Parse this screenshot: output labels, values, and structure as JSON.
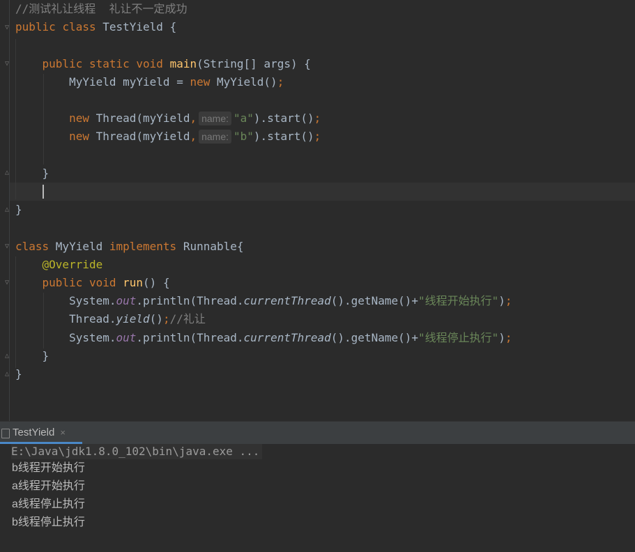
{
  "editor": {
    "lines": [
      {
        "parts": [
          {
            "t": "//测试礼让线程  礼让不一定成功",
            "c": "cmt"
          }
        ]
      },
      {
        "parts": [
          {
            "t": "public ",
            "c": "kw"
          },
          {
            "t": "class ",
            "c": "kw"
          },
          {
            "t": "TestYield {",
            "c": "cls"
          }
        ]
      },
      {
        "parts": []
      },
      {
        "parts": [
          {
            "t": "    "
          },
          {
            "t": "public ",
            "c": "kw"
          },
          {
            "t": "static ",
            "c": "kw"
          },
          {
            "t": "void ",
            "c": "kw"
          },
          {
            "t": "main",
            "c": "fn"
          },
          {
            "t": "(String[] args) {"
          }
        ]
      },
      {
        "parts": [
          {
            "t": "        MyYield myYield = "
          },
          {
            "t": "new ",
            "c": "kw"
          },
          {
            "t": "MyYield()"
          },
          {
            "t": ";",
            "c": "kw"
          }
        ]
      },
      {
        "parts": []
      },
      {
        "parts": [
          {
            "t": "        "
          },
          {
            "t": "new ",
            "c": "kw"
          },
          {
            "t": "Thread(myYield"
          },
          {
            "t": ",",
            "c": "kw"
          },
          {
            "hint": "name:"
          },
          {
            "t": "\"a\"",
            "c": "str"
          },
          {
            "t": ").start()"
          },
          {
            "t": ";",
            "c": "kw"
          }
        ]
      },
      {
        "parts": [
          {
            "t": "        "
          },
          {
            "t": "new ",
            "c": "kw"
          },
          {
            "t": "Thread(myYield"
          },
          {
            "t": ",",
            "c": "kw"
          },
          {
            "hint": "name:"
          },
          {
            "t": "\"b\"",
            "c": "str"
          },
          {
            "t": ").start()"
          },
          {
            "t": ";",
            "c": "kw"
          }
        ]
      },
      {
        "parts": []
      },
      {
        "parts": [
          {
            "t": "    }"
          }
        ]
      },
      {
        "parts": []
      },
      {
        "parts": [
          {
            "t": "}"
          }
        ]
      },
      {
        "parts": []
      },
      {
        "parts": [
          {
            "t": "class ",
            "c": "kw"
          },
          {
            "t": "MyYield "
          },
          {
            "t": "implements ",
            "c": "kw"
          },
          {
            "t": "Runnable{"
          }
        ]
      },
      {
        "parts": [
          {
            "t": "    "
          },
          {
            "t": "@Override",
            "c": "ann"
          }
        ]
      },
      {
        "parts": [
          {
            "t": "    "
          },
          {
            "t": "public ",
            "c": "kw"
          },
          {
            "t": "void ",
            "c": "kw"
          },
          {
            "t": "run",
            "c": "fn"
          },
          {
            "t": "() {"
          }
        ]
      },
      {
        "parts": [
          {
            "t": "        System."
          },
          {
            "t": "out",
            "c": "field"
          },
          {
            "t": ".println(Thread."
          },
          {
            "t": "currentThread",
            "c": "italic"
          },
          {
            "t": "().getName()+"
          },
          {
            "t": "\"线程开始执行\"",
            "c": "str"
          },
          {
            "t": ")"
          },
          {
            "t": ";",
            "c": "kw"
          }
        ]
      },
      {
        "parts": [
          {
            "t": "        Thread."
          },
          {
            "t": "yield",
            "c": "italic"
          },
          {
            "t": "()"
          },
          {
            "t": ";",
            "c": "kw"
          },
          {
            "t": "//礼让",
            "c": "cmt"
          }
        ]
      },
      {
        "parts": [
          {
            "t": "        System."
          },
          {
            "t": "out",
            "c": "field"
          },
          {
            "t": ".println(Thread."
          },
          {
            "t": "currentThread",
            "c": "italic"
          },
          {
            "t": "().getName()+"
          },
          {
            "t": "\"线程停止执行\"",
            "c": "str"
          },
          {
            "t": ")"
          },
          {
            "t": ";",
            "c": "kw"
          }
        ]
      },
      {
        "parts": [
          {
            "t": "    }"
          }
        ]
      },
      {
        "parts": [
          {
            "t": "}"
          }
        ]
      }
    ]
  },
  "run_panel": {
    "tab_label": "TestYield",
    "close_glyph": "×",
    "command": "E:\\Java\\jdk1.8.0_102\\bin\\java.exe ...",
    "output": [
      "b线程开始执行",
      "a线程开始执行",
      "a线程停止执行",
      "b线程停止执行"
    ]
  }
}
